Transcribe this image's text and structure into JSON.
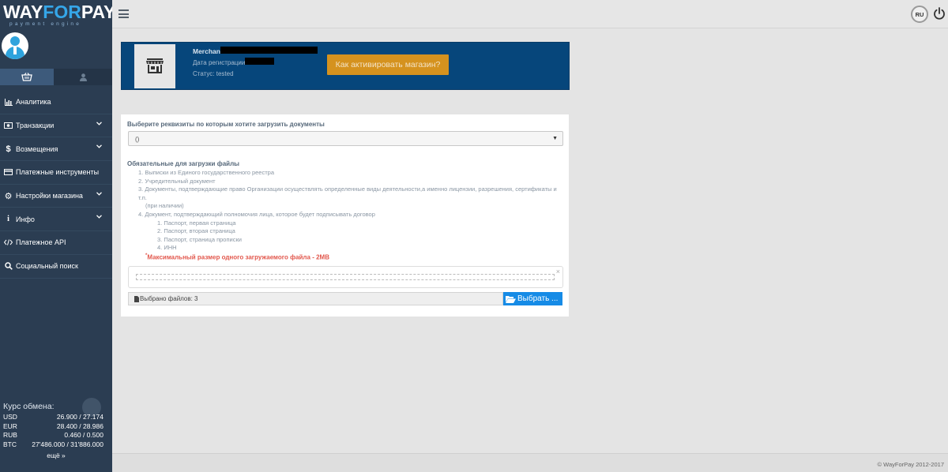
{
  "sidebar": {
    "logo": {
      "part1": "WAY",
      "part2": "FOR",
      "part3": "PAY",
      "subtitle": "payment engine"
    },
    "tabs": [
      {
        "icon": "basket-icon"
      },
      {
        "icon": "user-icon"
      }
    ],
    "items": [
      {
        "label": "Аналитика",
        "icon": "bar-chart-icon",
        "has_submenu": false
      },
      {
        "label": "Транзакции",
        "icon": "money-icon",
        "has_submenu": true
      },
      {
        "label": "Возмещения",
        "icon": "dollar-icon",
        "has_submenu": true
      },
      {
        "label": "Платежные инструменты",
        "icon": "credit-card-icon",
        "has_submenu": false
      },
      {
        "label": "Настройки магазина",
        "icon": "gear-icon",
        "has_submenu": true
      },
      {
        "label": "Инфо",
        "icon": "info-icon",
        "has_submenu": true
      },
      {
        "label": "Платежное API",
        "icon": "code-icon",
        "has_submenu": false
      },
      {
        "label": "Социальный поиск",
        "icon": "search-icon",
        "has_submenu": false
      }
    ],
    "rates": {
      "title": "Курс обмена:",
      "rows": [
        {
          "currency": "USD",
          "value": "26.900 / 27.174"
        },
        {
          "currency": "EUR",
          "value": "28.400 / 28.986"
        },
        {
          "currency": "RUB",
          "value": "0.460 / 0.500"
        },
        {
          "currency": "BTC",
          "value": "27'486.000 / 31'886.000"
        }
      ],
      "more": "ещё"
    }
  },
  "topbar": {
    "lang": "RU"
  },
  "merchant": {
    "title": "Merchant",
    "reg_label": "Дата регистрации:",
    "status": "Статус: tested",
    "activate_button": "Как активировать магазин?"
  },
  "upload": {
    "select_label": "Выберите реквизиты по которым хотите загрузить документы",
    "select_value": "()",
    "required_title": "Обязательные для загрузки файлы",
    "required": [
      "1. Выписки из Единого государственного реестра",
      "2. Учредительный документ",
      "3. Документы, подтверждающие право Организации осуществлять определенные виды деятельности,а именно лицензии, разрешения, сертификаты и т.п.",
      "(при наличии)",
      "4. Документ, подтверждающий полномочия лица, которое будет подписывать договор"
    ],
    "sub_required": [
      "1. Паспорт, первая страница",
      "2. Паспорт, вторая страница",
      "3. Паспорт, страница прописки",
      "4. ИНН"
    ],
    "max_size_asterisk": "*",
    "max_size": "Максимальный размер одного загружаемого файла - 2MB",
    "remove": "×",
    "files_selected": "Выбрано файлов: 3",
    "choose_button": "Выбрать ..."
  },
  "footer": {
    "copyright": "© WayForPay 2012-2017"
  }
}
